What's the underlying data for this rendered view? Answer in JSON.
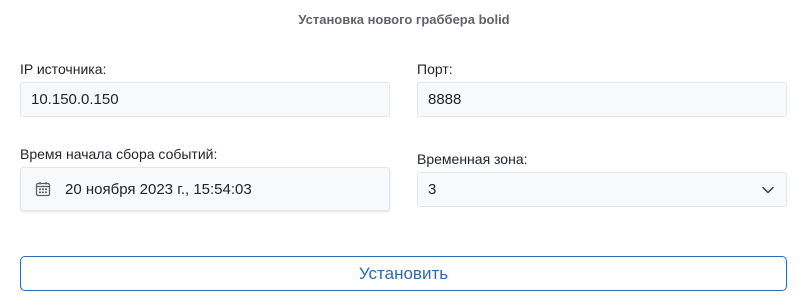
{
  "form": {
    "title": "Установка нового граббера bolid",
    "ip": {
      "label": "IP источника:",
      "value": "10.150.0.150"
    },
    "port": {
      "label": "Порт:",
      "value": "8888"
    },
    "start_time": {
      "label": "Время начала сбора событий:",
      "value": "20 ноября 2023 г., 15:54:03",
      "icon": "calendar-icon"
    },
    "timezone": {
      "label": "Временная зона:",
      "value": "3",
      "icon": "chevron-down-icon"
    },
    "submit_label": "Установить"
  },
  "colors": {
    "accent": "#2a6bb3",
    "field_bg": "#f8f9fa",
    "field_border": "#e3e6ea",
    "title": "#5f6368"
  }
}
